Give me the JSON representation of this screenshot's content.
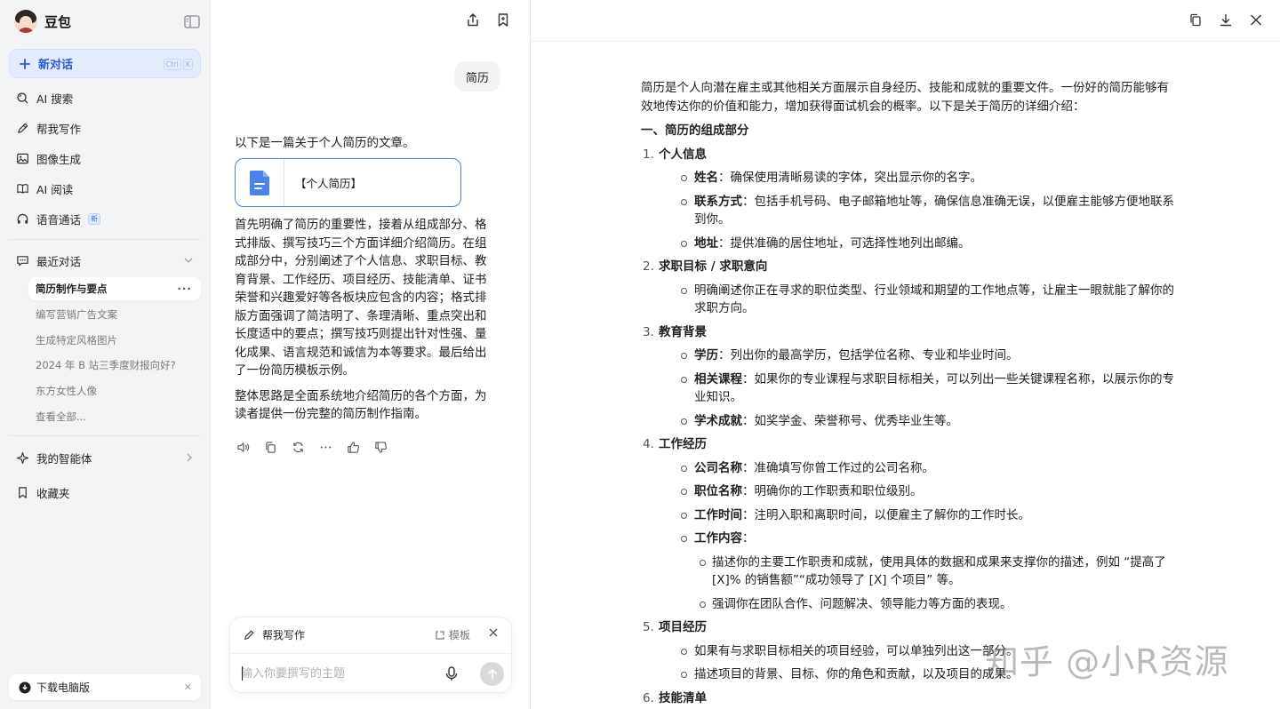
{
  "sidebar": {
    "brand": "豆包",
    "new_chat": {
      "label": "新对话",
      "kbd": [
        "Ctrl",
        "K"
      ]
    },
    "nav": [
      {
        "label": "AI 搜索",
        "icon": "search-icon"
      },
      {
        "label": "帮我写作",
        "icon": "pen-icon"
      },
      {
        "label": "图像生成",
        "icon": "image-icon"
      },
      {
        "label": "AI 阅读",
        "icon": "book-icon"
      },
      {
        "label": "语音通话",
        "icon": "headphones-icon",
        "badge": "新"
      }
    ],
    "recent": {
      "title": "最近对话",
      "items": [
        {
          "label": "简历制作与要点",
          "active": true
        },
        {
          "label": "编写营销广告文案"
        },
        {
          "label": "生成特定风格图片"
        },
        {
          "label": "2024 年 B 站三季度财报向好?"
        },
        {
          "label": "东方女性人像"
        },
        {
          "label": "查看全部..."
        }
      ]
    },
    "agents": "我的智能体",
    "favorites": "收藏夹",
    "download": "下载电脑版"
  },
  "chat": {
    "user_message": "简历",
    "bot_intro": "以下是一篇关于个人简历的文章。",
    "doc_card_title": "【个人简历】",
    "bot_paragraphs": [
      "首先明确了简历的重要性，接着从组成部分、格式排版、撰写技巧三个方面详细介绍简历。在组成部分中，分别阐述了个人信息、求职目标、教育背景、工作经历、项目经历、技能清单、证书荣誉和兴趣爱好等各板块应包含的内容；格式排版方面强调了简洁明了、条理清晰、重点突出和长度适中的要点；撰写技巧则提出针对性强、量化成果、语言规范和诚信为本等要求。最后给出了一份简历模板示例。",
      "整体思路是全面系统地介绍简历的各个方面，为读者提供一份完整的简历制作指南。"
    ],
    "composer": {
      "mode_label": "帮我写作",
      "template_label": "模板",
      "placeholder": "输入你要撰写的主题"
    }
  },
  "document": {
    "intro": "简历是个人向潜在雇主或其他相关方面展示自身经历、技能和成就的重要文件。一份好的简历能够有效地传达你的价值和能力，增加获得面试机会的概率。以下是关于简历的详细介绍：",
    "heading": "一、简历的组成部分",
    "sections": [
      {
        "num": "1.",
        "title": "个人信息",
        "bullets": [
          {
            "key": "姓名",
            "text": "：确保使用清晰易读的字体，突出显示你的名字。"
          },
          {
            "key": "联系方式",
            "text": "：包括手机号码、电子邮箱地址等，确保信息准确无误，以便雇主能够方便地联系到你。"
          },
          {
            "key": "地址",
            "text": "：提供准确的居住地址，可选择性地列出邮编。"
          }
        ]
      },
      {
        "num": "2.",
        "title": "求职目标 / 求职意向",
        "bullets": [
          {
            "key": "",
            "text": "明确阐述你正在寻求的职位类型、行业领域和期望的工作地点等，让雇主一眼就能了解你的求职方向。"
          }
        ]
      },
      {
        "num": "3.",
        "title": "教育背景",
        "bullets": [
          {
            "key": "学历",
            "text": "：列出你的最高学历，包括学位名称、专业和毕业时间。"
          },
          {
            "key": "相关课程",
            "text": "：如果你的专业课程与求职目标相关，可以列出一些关键课程名称，以展示你的专业知识。"
          },
          {
            "key": "学术成就",
            "text": "：如奖学金、荣誉称号、优秀毕业生等。"
          }
        ]
      },
      {
        "num": "4.",
        "title": "工作经历",
        "bullets": [
          {
            "key": "公司名称",
            "text": "：准确填写你曾工作过的公司名称。"
          },
          {
            "key": "职位名称",
            "text": "：明确你的工作职责和职位级别。"
          },
          {
            "key": "工作时间",
            "text": "：注明入职和离职时间，以便雇主了解你的工作时长。"
          },
          {
            "key": "工作内容",
            "text": "：",
            "sub": [
              "描述你的主要工作职责和成就，使用具体的数据和成果来支撑你的描述，例如 “提高了 [X]% 的销售额”“成功领导了 [X] 个项目” 等。",
              "强调你在团队合作、问题解决、领导能力等方面的表现。"
            ]
          }
        ]
      },
      {
        "num": "5.",
        "title": "项目经历",
        "bullets": [
          {
            "key": "",
            "text": "如果有与求职目标相关的项目经验，可以单独列出这一部分。"
          },
          {
            "key": "",
            "text": "描述项目的背景、目标、你的角色和贡献，以及项目的成果。"
          }
        ]
      },
      {
        "num": "6.",
        "title": "技能清单",
        "bullets": []
      }
    ]
  },
  "watermark": "知乎 @小R资源"
}
